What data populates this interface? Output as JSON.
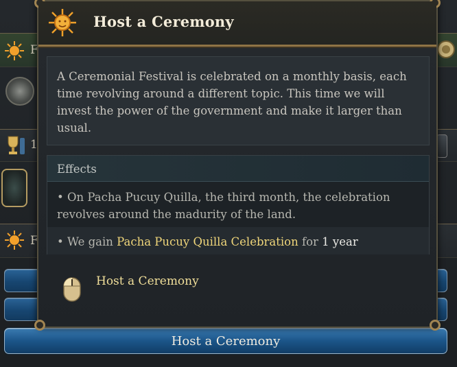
{
  "tooltip": {
    "title": "Host a Ceremony",
    "description": "A Ceremonial Festival is celebrated on a monthly basis, each time revolving around a different topic. This time we will invest the power of the government and make it larger than usual.",
    "effects_header": "Effects",
    "effects": [
      {
        "text": "• On Pacha Pucuy Quilla, the third month, the celebration revolves around the madurity of the land."
      },
      {
        "prefix": "• We gain ",
        "highlight": "Pacha Pucuy Quilla Celebration",
        "middle": " for ",
        "duration": "1 year"
      }
    ],
    "action_label": "Host a Ceremony"
  },
  "background": {
    "row_letters": [
      "F",
      "1",
      "F"
    ],
    "bottom_button_label": "Host a Ceremony"
  },
  "colors": {
    "accent_gold": "#f0d67a",
    "button_blue": "#1b5589",
    "border_gold": "#8e7345"
  },
  "icons": {
    "header": "sun-emblem-icon",
    "action": "mouse-left-click-icon"
  }
}
